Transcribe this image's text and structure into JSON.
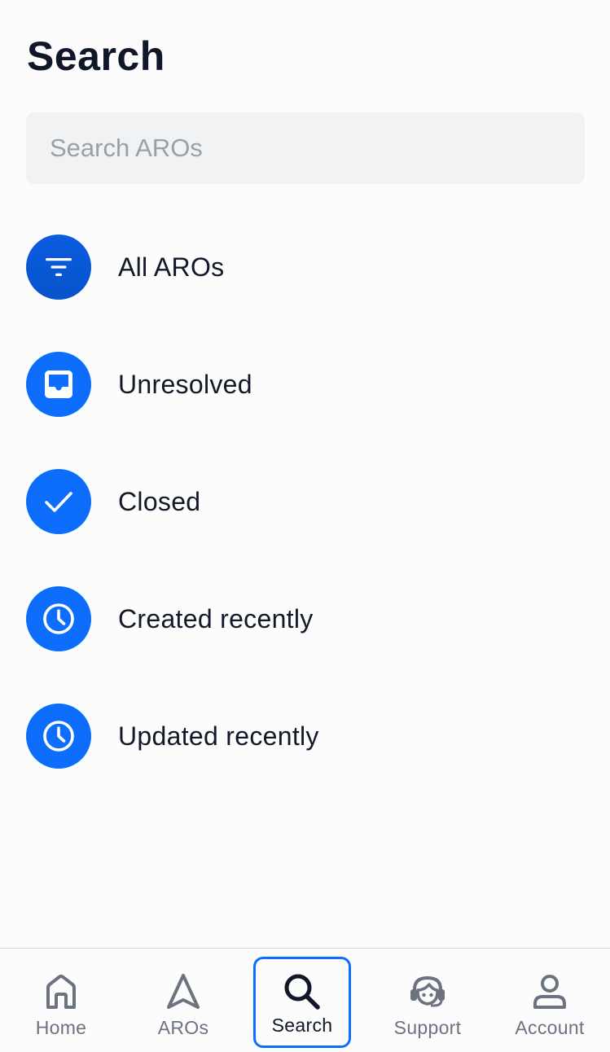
{
  "header": {
    "title": "Search"
  },
  "search": {
    "placeholder": "Search AROs",
    "value": ""
  },
  "filters": [
    {
      "label": "All AROs",
      "icon": "filter-lines-icon"
    },
    {
      "label": "Unresolved",
      "icon": "inbox-icon"
    },
    {
      "label": "Closed",
      "icon": "check-icon"
    },
    {
      "label": "Created recently",
      "icon": "clock-icon"
    },
    {
      "label": "Updated recently",
      "icon": "clock-icon"
    }
  ],
  "tabs": [
    {
      "label": "Home",
      "icon": "home-icon",
      "active": false
    },
    {
      "label": "AROs",
      "icon": "navigation-arrow-icon",
      "active": false
    },
    {
      "label": "Search",
      "icon": "search-icon",
      "active": true
    },
    {
      "label": "Support",
      "icon": "headset-icon",
      "active": false
    },
    {
      "label": "Account",
      "icon": "user-icon",
      "active": false
    }
  ],
  "colors": {
    "accent": "#0d6efd",
    "accent_dark": "#0753cc",
    "title": "#0f1729",
    "muted": "#6b7280",
    "search_bg": "#f1f2f4"
  }
}
